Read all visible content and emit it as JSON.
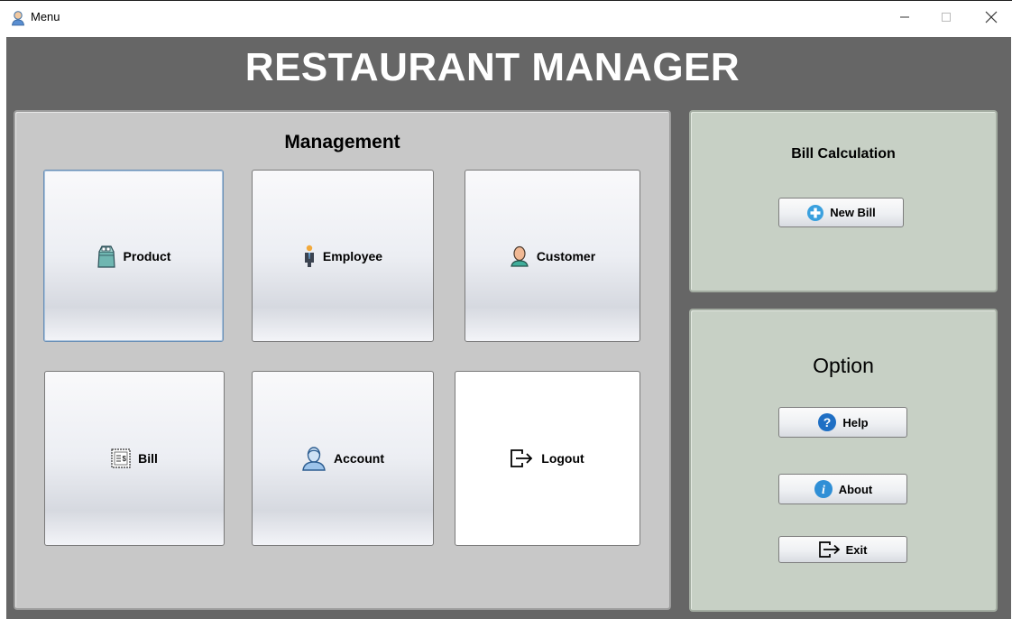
{
  "window": {
    "title": "Menu",
    "minimize_glyph": "—",
    "maximize_glyph": "☐",
    "close_glyph": "✕"
  },
  "app": {
    "title": "RESTAURANT MANAGER"
  },
  "management": {
    "heading": "Management",
    "tiles": [
      {
        "label": "Product",
        "icon": "product-bag-icon"
      },
      {
        "label": "Employee",
        "icon": "employee-icon"
      },
      {
        "label": "Customer",
        "icon": "customer-icon"
      },
      {
        "label": "Bill",
        "icon": "bill-icon"
      },
      {
        "label": "Account",
        "icon": "account-icon"
      },
      {
        "label": "Logout",
        "icon": "logout-icon"
      }
    ]
  },
  "bill_calculation": {
    "heading": "Bill Calculation",
    "new_bill_label": "New Bill"
  },
  "option": {
    "heading": "Option",
    "help_label": "Help",
    "about_label": "About",
    "exit_label": "Exit"
  },
  "colors": {
    "background": "#666666",
    "management_panel": "#c8c8c8",
    "side_panels": "#c7d0c5",
    "help_icon_blue": "#1f6fc4"
  }
}
